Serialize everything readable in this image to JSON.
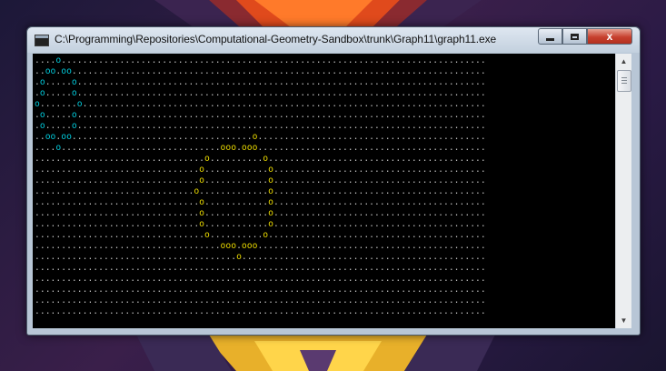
{
  "window": {
    "title": "C:\\Programming\\Repositories\\Computational-Geometry-Sandbox\\trunk\\Graph11\\graph11.exe",
    "minimize_label": "minimize",
    "maximize_label": "maximize",
    "close_label": "x"
  },
  "console": {
    "rows": 24,
    "cols": 85,
    "background": "#000000",
    "dot_color": "#c0c0c0",
    "cyan_color": "#00c8d8",
    "yellow_color": "#e8d800",
    "cyan_shape": [
      [
        0,
        4
      ],
      [
        1,
        2
      ],
      [
        1,
        3
      ],
      [
        1,
        5
      ],
      [
        1,
        6
      ],
      [
        2,
        1
      ],
      [
        2,
        7
      ],
      [
        3,
        1
      ],
      [
        3,
        7
      ],
      [
        4,
        0
      ],
      [
        4,
        8
      ],
      [
        5,
        1
      ],
      [
        5,
        7
      ],
      [
        6,
        1
      ],
      [
        6,
        7
      ],
      [
        7,
        2
      ],
      [
        7,
        3
      ],
      [
        7,
        5
      ],
      [
        7,
        6
      ],
      [
        8,
        4
      ]
    ],
    "yellow_shape": [
      [
        7,
        41
      ],
      [
        8,
        35
      ],
      [
        8,
        36
      ],
      [
        8,
        37
      ],
      [
        8,
        39
      ],
      [
        8,
        40
      ],
      [
        8,
        41
      ],
      [
        9,
        32
      ],
      [
        9,
        43
      ],
      [
        10,
        31
      ],
      [
        10,
        44
      ],
      [
        11,
        31
      ],
      [
        11,
        44
      ],
      [
        12,
        30
      ],
      [
        12,
        44
      ],
      [
        13,
        31
      ],
      [
        13,
        44
      ],
      [
        14,
        31
      ],
      [
        14,
        44
      ],
      [
        15,
        31
      ],
      [
        15,
        44
      ],
      [
        16,
        32
      ],
      [
        16,
        43
      ],
      [
        17,
        35
      ],
      [
        17,
        36
      ],
      [
        17,
        37
      ],
      [
        17,
        39
      ],
      [
        17,
        40
      ],
      [
        17,
        41
      ],
      [
        18,
        38
      ]
    ]
  }
}
